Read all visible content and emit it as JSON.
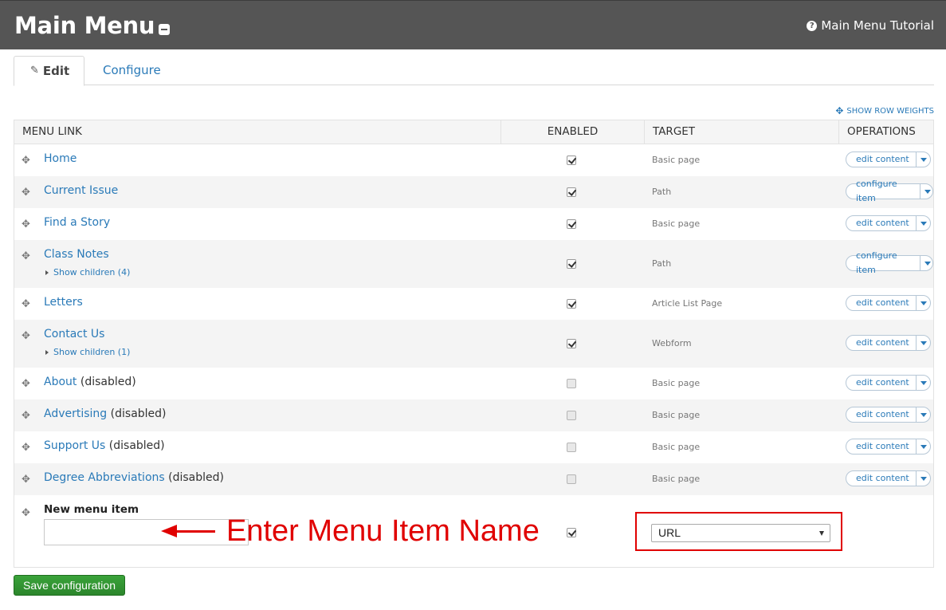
{
  "header": {
    "title": "Main Menu",
    "tutorial_link": "Main Menu Tutorial"
  },
  "tabs": [
    {
      "label": "Edit",
      "active": true
    },
    {
      "label": "Configure",
      "active": false
    }
  ],
  "row_weights_label": "SHOW ROW WEIGHTS",
  "table": {
    "columns": [
      "MENU LINK",
      "ENABLED",
      "TARGET",
      "OPERATIONS"
    ],
    "rows": [
      {
        "link": "Home",
        "suffix": "",
        "children": "",
        "enabled": true,
        "target": "Basic page",
        "op": "edit content"
      },
      {
        "link": "Current Issue",
        "suffix": "",
        "children": "",
        "enabled": true,
        "target": "Path",
        "op": "configure item"
      },
      {
        "link": "Find a Story",
        "suffix": "",
        "children": "",
        "enabled": true,
        "target": "Basic page",
        "op": "edit content"
      },
      {
        "link": "Class Notes",
        "suffix": "",
        "children": "Show children (4)",
        "enabled": true,
        "target": "Path",
        "op": "configure item"
      },
      {
        "link": "Letters",
        "suffix": "",
        "children": "",
        "enabled": true,
        "target": "Article List Page",
        "op": "edit content"
      },
      {
        "link": "Contact Us",
        "suffix": "",
        "children": "Show children (1)",
        "enabled": true,
        "target": "Webform",
        "op": "edit content"
      },
      {
        "link": "About",
        "suffix": "(disabled)",
        "children": "",
        "enabled": false,
        "target": "Basic page",
        "op": "edit content"
      },
      {
        "link": "Advertising",
        "suffix": "(disabled)",
        "children": "",
        "enabled": false,
        "target": "Basic page",
        "op": "edit content"
      },
      {
        "link": "Support Us",
        "suffix": "(disabled)",
        "children": "",
        "enabled": false,
        "target": "Basic page",
        "op": "edit content"
      },
      {
        "link": "Degree Abbreviations",
        "suffix": "(disabled)",
        "children": "",
        "enabled": false,
        "target": "Basic page",
        "op": "edit content"
      }
    ]
  },
  "new_item": {
    "label": "New menu item",
    "input_value": "",
    "enabled": true,
    "target_selected": "URL"
  },
  "annotation": {
    "text": "Enter Menu Item Name",
    "color": "#e00000"
  },
  "save_button": "Save configuration",
  "colors": {
    "header_bg": "#555555",
    "link": "#2a7ab8",
    "save_green": "#2f8f2f"
  }
}
